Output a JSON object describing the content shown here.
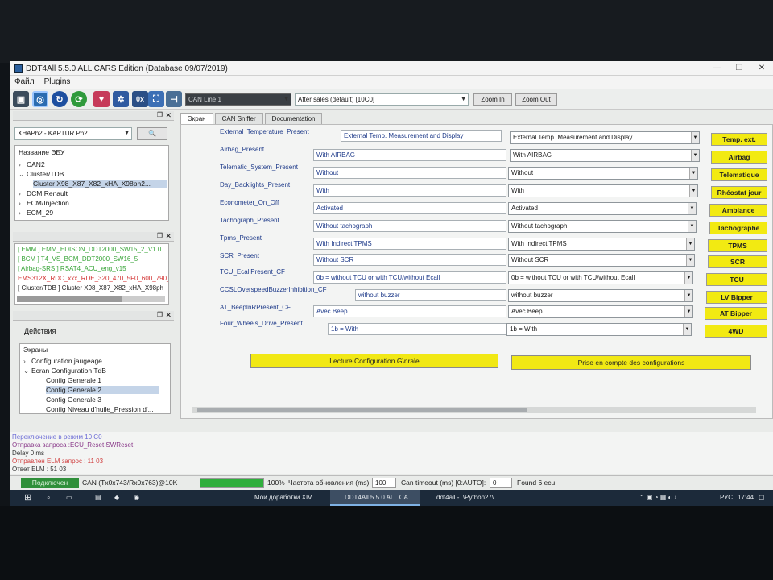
{
  "window": {
    "title": "DDT4All 5.5.0 ALL CARS Edition (Database 09/07/2019)",
    "menu": [
      "Файл",
      "Plugins"
    ]
  },
  "toolbar": {
    "can_line": "CAN Line 1",
    "session": "After sales (default) [10C0]",
    "zoom_in": "Zoom In",
    "zoom_out": "Zoom Out",
    "ox_icon_label": "0x"
  },
  "vehicle_panel": {
    "vehicle_select": "XHAPh2 - KAPTUR Ph2",
    "tree_header": "Название ЭБУ",
    "tree": [
      {
        "label": "CAN2",
        "expanded": false
      },
      {
        "label": "Cluster/TDB",
        "expanded": true
      },
      {
        "label": "Cluster X98_X87_X82_xHA_X98ph2...",
        "child": true
      },
      {
        "label": "DCM Renault",
        "expanded": false
      },
      {
        "label": "ECM/Injection",
        "expanded": false
      },
      {
        "label": "ECM_29",
        "expanded": false
      }
    ]
  },
  "ecu_list": [
    {
      "text": "[ EMM ] EMM_EDISON_DDT2000_SW15_2_V1.0",
      "color": "#3aa53a"
    },
    {
      "text": "[ BCM ] T4_VS_BCM_DDT2000_SW16_5",
      "color": "#3aa53a"
    },
    {
      "text": "[ Airbag-SRS ] RSAT4_ACU_eng_v15",
      "color": "#3aa53a"
    },
    {
      "text": "EMS312X_RDC_xxx_RDE_320_470_5F0_600_790_8",
      "color": "#d23030"
    },
    {
      "text": "[ Cluster/TDB ] Cluster X98_X87_X82_xHA_X98ph",
      "color": "#222222"
    }
  ],
  "actions_panel": {
    "title": "Действия",
    "screens_header": "Экраны",
    "items": [
      {
        "label": "Configuration jaugeage",
        "level": 1
      },
      {
        "label": "Ecran Configuration TdB",
        "level": 1
      },
      {
        "label": "Config Generale 1",
        "level": 2
      },
      {
        "label": "Config Generale 2",
        "level": 2,
        "selected": true
      },
      {
        "label": "Config Generale 3",
        "level": 2
      },
      {
        "label": "Config Niveau d'huile_Pression d'...",
        "level": 2
      }
    ]
  },
  "tabs": [
    "Экран",
    "CAN Sniffer",
    "Documentation"
  ],
  "config_rows": [
    {
      "label": "External_Temperature_Present",
      "value": "External Temp. Measurement and Display",
      "option": "External Temp. Measurement and Display",
      "button": "Temp. ext."
    },
    {
      "label": "Airbag_Present",
      "value": "With AIRBAG",
      "option": "With AIRBAG",
      "button": "Airbag"
    },
    {
      "label": "Telematic_System_Present",
      "value": "Without",
      "option": "Without",
      "button": "Telematique"
    },
    {
      "label": "Day_Backlights_Present",
      "value": "With",
      "option": "With",
      "button": "Rhéostat jour"
    },
    {
      "label": "Econometer_On_Off",
      "value": "Activated",
      "option": "Activated",
      "button": "Ambiance"
    },
    {
      "label": "Tachograph_Present",
      "value": "Without tachograph",
      "option": "Without tachograph",
      "button": "Tachographe"
    },
    {
      "label": "Tpms_Present",
      "value": "With Indirect TPMS",
      "option": "With Indirect TPMS",
      "button": "TPMS"
    },
    {
      "label": "SCR_Present",
      "value": "Without SCR",
      "option": "Without SCR",
      "button": "SCR"
    },
    {
      "label": "TCU_EcallPresent_CF",
      "value": "0b = without TCU or with TCU/without Ecall",
      "option": "0b = without TCU or with TCU/without Ecall",
      "button": "TCU"
    },
    {
      "label": "CCSLOverspeedBuzzerInhibition_CF",
      "value": "without buzzer",
      "option": "without buzzer",
      "button": "LV Bipper"
    },
    {
      "label": "AT_BeepInRPresent_CF",
      "value": "Avec Beep",
      "option": "Avec Beep",
      "button": "AT Bipper"
    },
    {
      "label": "Four_Wheels_Drive_Present",
      "value": "1b = With",
      "option": "1b = With",
      "button": "4WD"
    }
  ],
  "actions": {
    "read_config": "Lecture Configuration G\\nrale",
    "apply_config": "Prise en compte des configurations"
  },
  "log": [
    {
      "text": "Переключение в режим 10 C0",
      "color": "#6b6bd6"
    },
    {
      "text": "Отправка запроса :ECU_Reset.SWReset",
      "color": "#8a3a8a"
    },
    {
      "text": "Delay 0 ms",
      "color": "#333333"
    },
    {
      "text": "Отправлен ELM запрос : 11 03",
      "color": "#d04040"
    },
    {
      "text": "Ответ ELM : 51 03",
      "color": "#333333"
    }
  ],
  "status": {
    "connection": "Подключен",
    "can_info": "CAN (Tx0x743/Rx0x763)@10K",
    "progress_percent": "100%",
    "progress_fraction": 1.0,
    "refresh_label": "Частота обновления (ms):",
    "refresh_value": "100",
    "timeout_label": "Can timeout (ms) [0:AUTO]:",
    "timeout_value": "0",
    "found": "Found 6 ecu"
  },
  "taskbar": {
    "apps": [
      {
        "label": "Мои доработки XIV ...",
        "active": false
      },
      {
        "label": "DDT4All 5.5.0 ALL CA...",
        "active": true
      },
      {
        "label": "ddt4all - .\\Python27\\...",
        "active": false
      }
    ],
    "lang": "РУС",
    "time": "17:44"
  }
}
